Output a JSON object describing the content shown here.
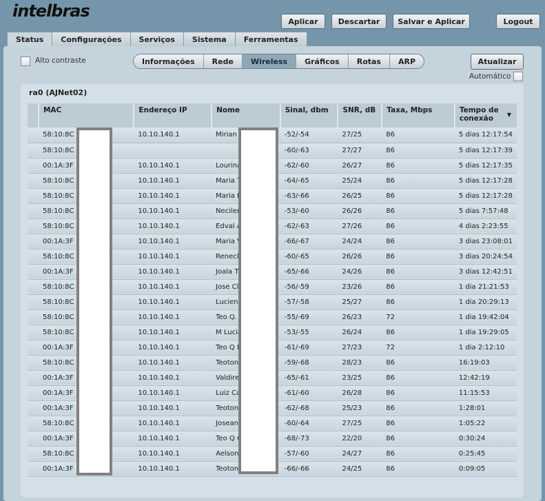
{
  "logo": "intelbras",
  "top_buttons": {
    "apply": "Aplicar",
    "discard": "Descartar",
    "save_apply": "Salvar e Aplicar",
    "logout": "Logout"
  },
  "tabs": [
    "Status",
    "Configurações",
    "Serviços",
    "Sistema",
    "Ferramentas"
  ],
  "high_contrast": "Alto contraste",
  "subtabs": [
    "Informações",
    "Rede",
    "Wireless",
    "Gráficos",
    "Rotas",
    "ARP"
  ],
  "refresh": "Atualizar",
  "automatic": "Automático",
  "section_title": "ra0 (AJNet02)",
  "columns": [
    "MAC",
    "Endereço IP",
    "Nome",
    "Sinal, dbm",
    "SNR, dB",
    "Taxa, Mbps",
    "Tempo de conexão"
  ],
  "sort_icon": "▼",
  "rows": [
    [
      "58:10:8C",
      "10.10.140.1",
      "Mirian T",
      "-52/-54",
      "27/25",
      "86",
      "5 dias 12:17:54"
    ],
    [
      "58:10:8C",
      "",
      "",
      "-60/-63",
      "27/27",
      "86",
      "5 dias 12:17:39"
    ],
    [
      "00:1A:3F",
      "10.10.140.1",
      "Lourina",
      "-62/-60",
      "26/27",
      "86",
      "5 dias 12:17:35"
    ],
    [
      "58:10:8C",
      "10.10.140.1",
      "Maria T",
      "-64/-65",
      "25/24",
      "86",
      "5 dias 12:17:28"
    ],
    [
      "58:10:8C",
      "10.10.140.1",
      "Maria B",
      "-63/-66",
      "26/25",
      "86",
      "5 dias 12:17:28"
    ],
    [
      "58:10:8C",
      "10.10.140.1",
      "Necilen",
      "-53/-60",
      "26/26",
      "86",
      "5 dias 7:57:48"
    ],
    [
      "58:10:8C",
      "10.10.140.1",
      "Edval A",
      "-62/-63",
      "27/26",
      "86",
      "4 dias 2:23:55"
    ],
    [
      "00:1A:3F",
      "10.10.140.1",
      "Maria V",
      "-66/-67",
      "24/24",
      "86",
      "3 dias 23:08:01"
    ],
    [
      "58:10:8C",
      "10.10.140.1",
      "Renecle",
      "-60/-65",
      "26/26",
      "86",
      "3 dias 20:24:54"
    ],
    [
      "00:1A:3F",
      "10.10.140.1",
      "Joala T",
      "-65/-66",
      "24/26",
      "86",
      "3 dias 12:42:51"
    ],
    [
      "58:10:8C",
      "10.10.140.1",
      "Jose Cl",
      "-56/-59",
      "23/26",
      "86",
      "1 dia 21:21:53"
    ],
    [
      "58:10:8C",
      "10.10.140.1",
      "Luciene",
      "-57/-58",
      "25/27",
      "86",
      "1 dia 20:29:13"
    ],
    [
      "58:10:8C",
      "10.10.140.1",
      "Teo Q.",
      "-55/-69",
      "26/23",
      "72",
      "1 dia 19:42:04"
    ],
    [
      "58:10:8C",
      "10.10.140.1",
      "M Lucia",
      "-53/-55",
      "26/24",
      "86",
      "1 dia 19:29:05"
    ],
    [
      "00:1A:3F",
      "10.10.140.1",
      "Teo Q I",
      "-61/-69",
      "27/23",
      "72",
      "1 dia 2:12:10"
    ],
    [
      "58:10:8C",
      "10.10.140.1",
      "Teotoni",
      "-59/-68",
      "28/23",
      "86",
      "16:19:03"
    ],
    [
      "00:1A:3F",
      "10.10.140.1",
      "Valdire",
      "-65/-61",
      "23/25",
      "86",
      "12:42:19"
    ],
    [
      "00:1A:3F",
      "10.10.140.1",
      "Luiz Ca",
      "-61/-60",
      "26/28",
      "86",
      "11:15:53"
    ],
    [
      "00:1A:3F",
      "10.10.140.1",
      "Teotoni",
      "-62/-68",
      "25/23",
      "86",
      "1:28:01"
    ],
    [
      "58:10:8C",
      "10.10.140.1",
      "Josean",
      "-60/-64",
      "27/25",
      "86",
      "1:05:22"
    ],
    [
      "00:1A:3F",
      "10.10.140.1",
      "Teo Q C",
      "-68/-73",
      "22/20",
      "86",
      "0:30:24"
    ],
    [
      "58:10:8C",
      "10.10.140.1",
      "Aelson",
      "-57/-60",
      "24/27",
      "86",
      "0:25:45"
    ],
    [
      "00:1A:3F",
      "10.10.140.1",
      "Teotoni",
      "-66/-66",
      "24/25",
      "86",
      "0:09:05"
    ]
  ]
}
